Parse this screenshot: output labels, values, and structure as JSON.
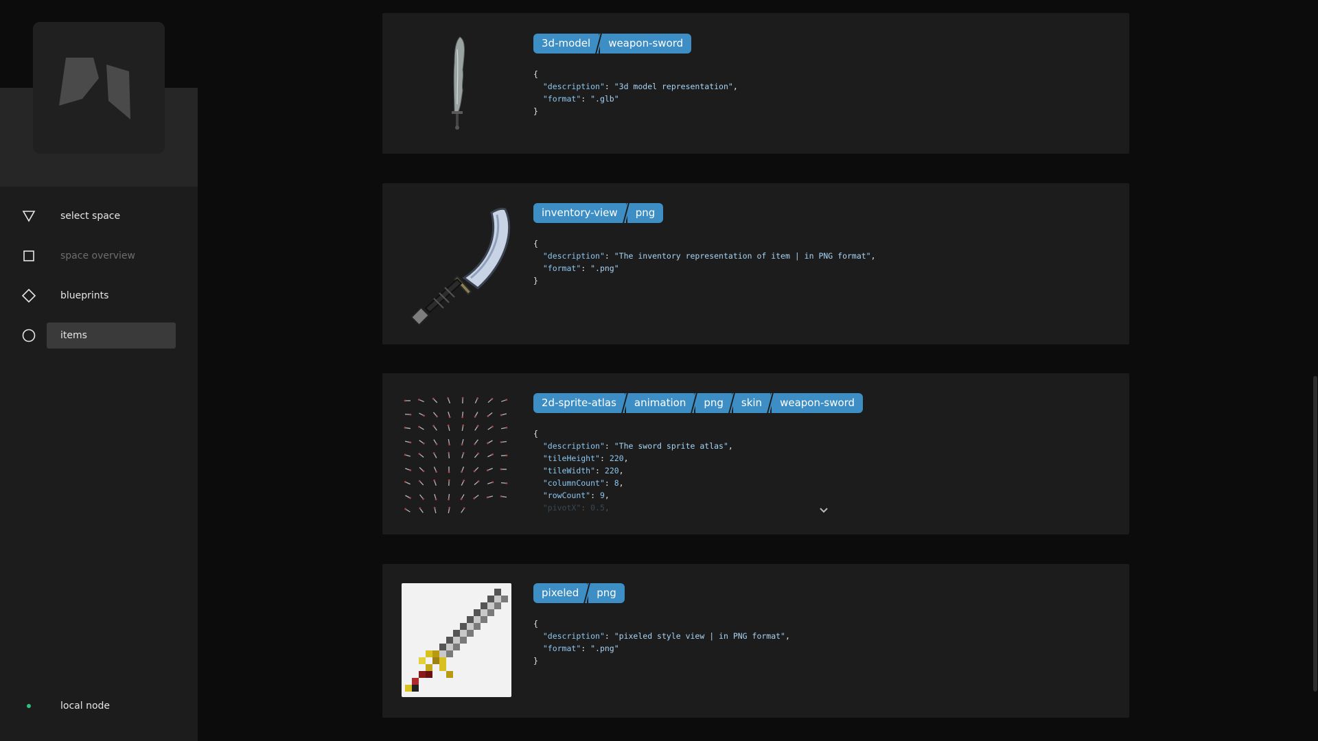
{
  "sidebar": {
    "items": [
      {
        "label": "select space",
        "icon": "triangle-down-icon"
      },
      {
        "label": "space overview",
        "icon": "square-icon"
      },
      {
        "label": "blueprints",
        "icon": "diamond-icon"
      },
      {
        "label": "items",
        "icon": "circle-icon"
      }
    ],
    "active_item": "items",
    "node_status": {
      "label": "local node",
      "color": "#2ec27e"
    }
  },
  "colors": {
    "tag_bg": "#3d8ec4",
    "card_bg": "#1c1c1c",
    "json_key": "#8ec7ef"
  },
  "cards": [
    {
      "thumb": "3d-sword-icon",
      "tags": [
        "3d-model",
        "weapon-sword"
      ],
      "json": {
        "open": "{",
        "lines": [
          {
            "key": "\"description\"",
            "value": "\"3d model representation\"",
            "tail": ","
          },
          {
            "key": "\"format\"",
            "value": "\".glb\"",
            "tail": ""
          }
        ],
        "close": "}"
      }
    },
    {
      "thumb": "curved-sword-icon",
      "tags": [
        "inventory-view",
        "png"
      ],
      "json": {
        "open": "{",
        "lines": [
          {
            "key": "\"description\"",
            "value": "\"The inventory representation of item | in PNG format\"",
            "tail": ","
          },
          {
            "key": "\"format\"",
            "value": "\".png\"",
            "tail": ""
          }
        ],
        "close": "}"
      }
    },
    {
      "thumb": "sprite-atlas-icon",
      "tags": [
        "2d-sprite-atlas",
        "animation",
        "png",
        "skin",
        "weapon-sword"
      ],
      "json": {
        "open": "{",
        "lines": [
          {
            "key": "\"description\"",
            "value": "\"The sword sprite atlas\"",
            "tail": ","
          },
          {
            "key": "\"tileHeight\"",
            "value": "220",
            "tail": ","
          },
          {
            "key": "\"tileWidth\"",
            "value": "220",
            "tail": ","
          },
          {
            "key": "\"columnCount\"",
            "value": "8",
            "tail": ","
          },
          {
            "key": "\"rowCount\"",
            "value": "9",
            "tail": ","
          },
          {
            "key": "\"pivotX\"",
            "value": "0.5",
            "tail": ","
          }
        ],
        "close": ""
      }
    },
    {
      "thumb": "pixel-sword-icon",
      "tags": [
        "pixeled",
        "png"
      ],
      "json": {
        "open": "{",
        "lines": [
          {
            "key": "\"description\"",
            "value": "\"pixeled style view | in PNG format\"",
            "tail": ","
          },
          {
            "key": "\"format\"",
            "value": "\".png\"",
            "tail": ""
          }
        ],
        "close": "}"
      }
    }
  ]
}
